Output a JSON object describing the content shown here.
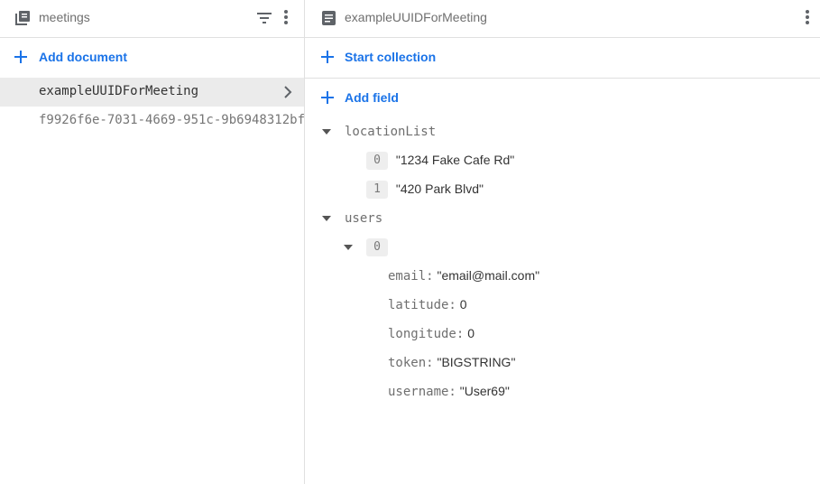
{
  "collection_panel": {
    "title": "meetings",
    "add_document_label": "Add document",
    "documents": [
      {
        "id": "exampleUUIDForMeeting",
        "selected": true
      },
      {
        "id": "f9926f6e-7031-4669-951c-9b6948312bf",
        "selected": false
      }
    ]
  },
  "document_panel": {
    "title": "exampleUUIDForMeeting",
    "start_collection_label": "Start collection",
    "add_field_label": "Add field",
    "fields": {
      "locationList": {
        "key": "locationList",
        "items": [
          {
            "index": "0",
            "value": "\"1234 Fake Cafe Rd\""
          },
          {
            "index": "1",
            "value": "\"420 Park Blvd\""
          }
        ]
      },
      "users": {
        "key": "users",
        "item_index": "0",
        "entries": [
          {
            "key": "email:",
            "value": "\"email@mail.com\""
          },
          {
            "key": "latitude:",
            "value": "0"
          },
          {
            "key": "longitude:",
            "value": "0"
          },
          {
            "key": "token:",
            "value": "\"BIGSTRING\""
          },
          {
            "key": "username:",
            "value": "\"User69\""
          }
        ]
      }
    }
  },
  "icons": {
    "collection": "collection-icon",
    "filter": "filter-icon",
    "more": "more-vert-icon",
    "document": "document-icon",
    "add": "add-icon",
    "chevron": "chevron-right-icon",
    "expand": "expand-triangle-icon"
  },
  "colors": {
    "accent": "#1a73e8",
    "selected_bg": "#ebebeb",
    "divider": "#e0e0e0",
    "index_bg": "#eeeeee"
  }
}
